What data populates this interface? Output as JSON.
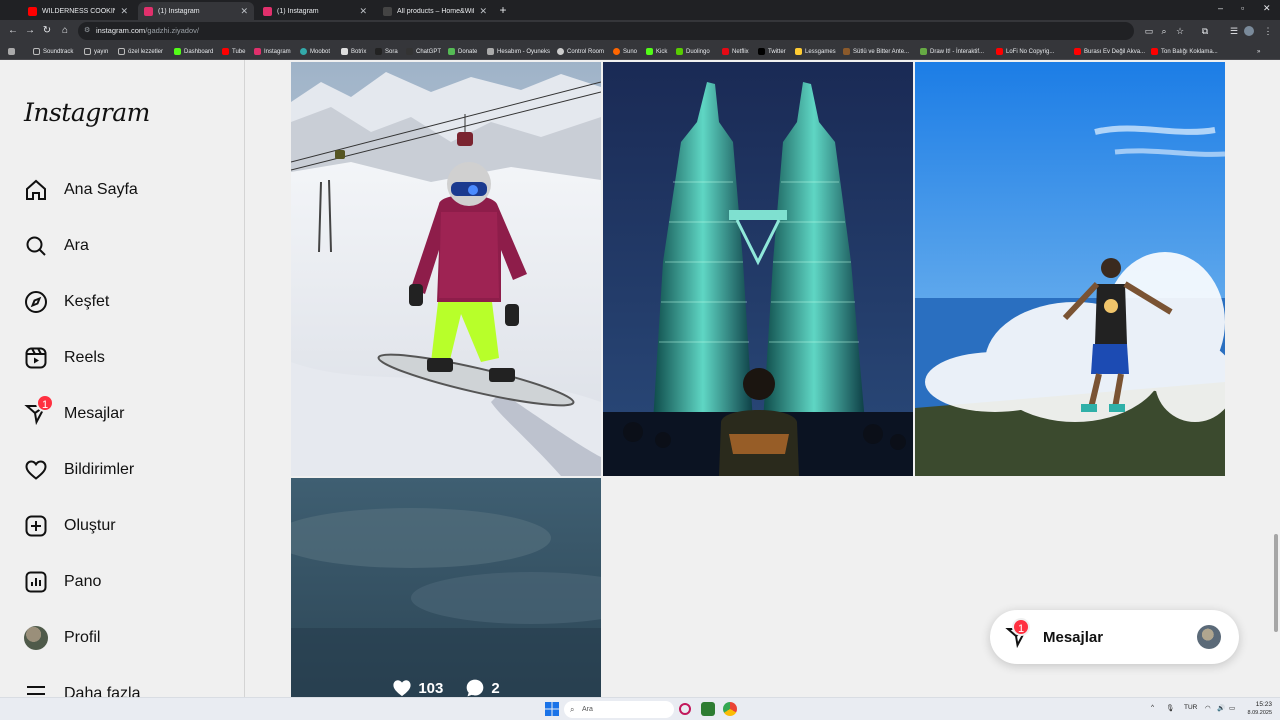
{
  "browser": {
    "tabs": [
      {
        "title": "WILDERNESS COOKING - YouT",
        "color": "#ff0000",
        "active": false
      },
      {
        "title": "(1) Instagram",
        "color": "#e1306c",
        "active": true
      },
      {
        "title": "(1) Instagram",
        "color": "#e1306c",
        "active": false
      },
      {
        "title": "All products – Home&Wild",
        "color": "#444",
        "active": false
      }
    ],
    "new_tab": "+",
    "url_domain": "instagram.com",
    "url_path": "/gadzhi.ziyadov/",
    "bookmarks": [
      {
        "label": "Soundtrack",
        "color": "#888"
      },
      {
        "label": "yayın",
        "color": "#888"
      },
      {
        "label": "özel lezzetler",
        "color": "#888"
      },
      {
        "label": "Dashboard",
        "color": "#53fc18"
      },
      {
        "label": "Tube",
        "color": "#ff0000"
      },
      {
        "label": "Instagram",
        "color": "#e1306c"
      },
      {
        "label": "Moobot",
        "color": "#3aa"
      },
      {
        "label": "Botrix",
        "color": "#ddd"
      },
      {
        "label": "Sora",
        "color": "#222"
      },
      {
        "label": "ChatGPT",
        "color": "#333"
      },
      {
        "label": "Donate",
        "color": "#5b5"
      },
      {
        "label": "Hesabım - Oyuneks",
        "color": "#aaa"
      },
      {
        "label": "Control Room",
        "color": "#ccc"
      },
      {
        "label": "Suno",
        "color": "#f60"
      },
      {
        "label": "Kick",
        "color": "#53fc18"
      },
      {
        "label": "Duolingo",
        "color": "#58cc02"
      },
      {
        "label": "Netflix",
        "color": "#e50914"
      },
      {
        "label": "Twitter",
        "color": "#000"
      },
      {
        "label": "Lessgames",
        "color": "#fc3"
      },
      {
        "label": "Sütlü ve Bitter Ante...",
        "color": "#8b5a2b"
      },
      {
        "label": "Draw It! - İnteraktif...",
        "color": "#6a4"
      },
      {
        "label": "LoFi No Copyrig...",
        "color": "#ff0000"
      },
      {
        "label": "Burası Ev Değil Akva...",
        "color": "#ff0000"
      },
      {
        "label": "Ton Balığı Koklama...",
        "color": "#ff0000"
      }
    ]
  },
  "sidebar": {
    "logo": "Instagram",
    "items": [
      {
        "label": "Ana Sayfa",
        "icon": "home-icon"
      },
      {
        "label": "Ara",
        "icon": "search-icon"
      },
      {
        "label": "Keşfet",
        "icon": "compass-icon"
      },
      {
        "label": "Reels",
        "icon": "reels-icon"
      },
      {
        "label": "Mesajlar",
        "icon": "messenger-icon",
        "badge": "1"
      },
      {
        "label": "Bildirimler",
        "icon": "heart-icon"
      },
      {
        "label": "Oluştur",
        "icon": "plus-square-icon"
      },
      {
        "label": "Pano",
        "icon": "dashboard-icon"
      },
      {
        "label": "Profil",
        "icon": "avatar"
      },
      {
        "label": "Daha fazla",
        "icon": "menu-icon"
      }
    ]
  },
  "posts": [
    {
      "subject": "snowboarder on mountain slope"
    },
    {
      "subject": "Petronas twin towers at night"
    },
    {
      "subject": "man standing in crashing wave"
    },
    {
      "subject": "cloudy sky",
      "likes": "103",
      "comments": "2"
    }
  ],
  "message_pill": {
    "label": "Mesajlar",
    "badge": "1"
  },
  "taskbar": {
    "search_placeholder": "Ara",
    "lang": "TUR",
    "time": "15:23",
    "date": "8.09.2025"
  },
  "colors": {
    "badge": "#ff3040",
    "background": "#f0f0f0"
  }
}
